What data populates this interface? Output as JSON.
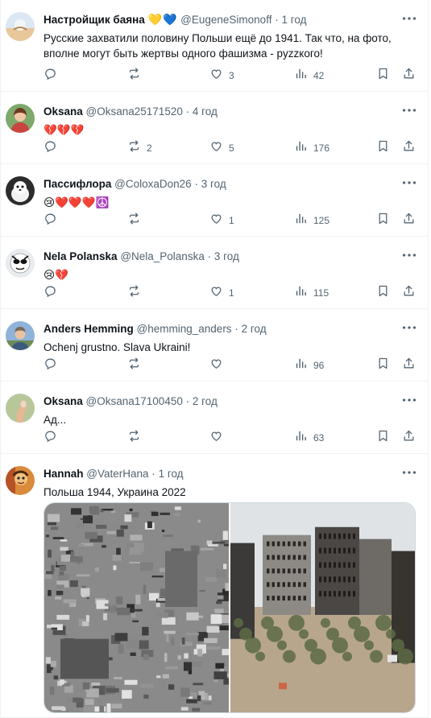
{
  "tweets": [
    {
      "name": "Настройщик баяна",
      "name_emoji": "💛💙",
      "handle": "@EugeneSimonoff",
      "time": "1 год",
      "text": "Русские захватили половину Польши ещё до 1941. Так что, на фото, вполне могут быть жертвы одного фашизма - pyzzкого!",
      "replies": "",
      "retweets": "",
      "likes": "3",
      "views": "42"
    },
    {
      "name": "Oksana",
      "handle": "@Oksana25171520",
      "time": "4 год",
      "text": "💔💔💔",
      "replies": "",
      "retweets": "2",
      "likes": "5",
      "views": "176"
    },
    {
      "name": "Пассифлора",
      "handle": "@ColoxaDon26",
      "time": "3 год",
      "text": "😢❤️❤️❤️☮️",
      "replies": "",
      "retweets": "",
      "likes": "1",
      "views": "125"
    },
    {
      "name": "Nela Polanska",
      "handle": "@Nela_Polanska",
      "time": "3 год",
      "text": "😢💔",
      "replies": "",
      "retweets": "",
      "likes": "1",
      "views": "115"
    },
    {
      "name": "Anders Hemming",
      "handle": "@hemming_anders",
      "time": "2 год",
      "text": "Ochenj grustno. Slava Ukraini!",
      "replies": "",
      "retweets": "",
      "likes": "",
      "views": "96"
    },
    {
      "name": "Oksana",
      "handle": "@Oksana17100450",
      "time": "2 год",
      "text": "Ад...",
      "replies": "",
      "retweets": "",
      "likes": "",
      "views": "63"
    },
    {
      "name": "Hannah",
      "handle": "@VaterHana",
      "time": "1 год",
      "text": "Польша 1944, Украина 2022",
      "replies": "",
      "retweets": "",
      "likes": "",
      "views": ""
    }
  ],
  "separator": "·",
  "icons": {
    "more": "more-horizontal-icon",
    "reply": "reply-icon",
    "retweet": "retweet-icon",
    "like": "heart-icon",
    "views": "views-chart-icon",
    "bookmark": "bookmark-icon",
    "share": "share-icon"
  },
  "colors": {
    "text": "#0f1419",
    "secondary": "#536471",
    "border": "#eff3f4"
  }
}
